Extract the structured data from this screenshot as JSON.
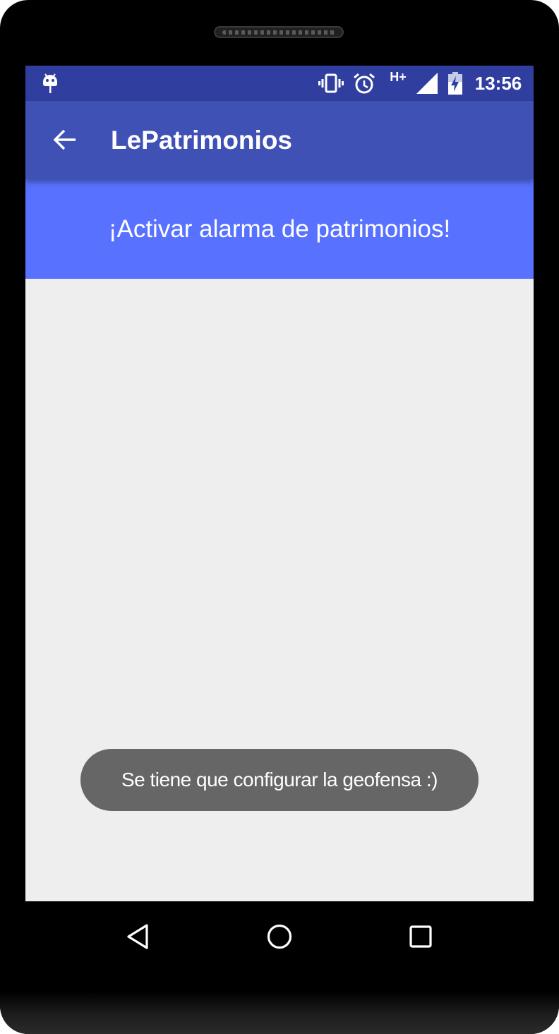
{
  "status_bar": {
    "time": "13:56",
    "network_type": "H+",
    "icons": [
      "android-debug-icon",
      "vibrate-icon",
      "alarm-clock-icon",
      "signal-icon",
      "battery-charging-icon"
    ]
  },
  "app_bar": {
    "title": "LePatrimonios",
    "back_icon": "arrow-back-icon"
  },
  "main": {
    "banner_label": "¡Activar alarma de patrimonios!"
  },
  "toast": {
    "message": "Se tiene que configurar la geofensa :)"
  },
  "nav_bar": {
    "buttons": [
      "back-triangle-icon",
      "home-circle-icon",
      "recents-square-icon"
    ]
  },
  "colors": {
    "status_bar": "#303f9f",
    "app_bar": "#3f51b5",
    "banner": "#5872ff",
    "background": "#eeeeee",
    "toast": "#666666"
  }
}
